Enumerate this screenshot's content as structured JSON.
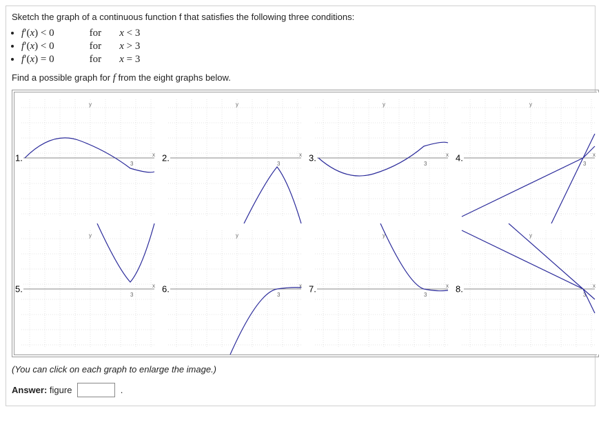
{
  "prompt": "Sketch the graph of a continuous function f that satisfies the following three conditions:",
  "conditions": [
    {
      "expr": "f′(x) < 0",
      "for": "for",
      "where": "x < 3"
    },
    {
      "expr": "f′(x) < 0",
      "for": "for",
      "where": "x > 3"
    },
    {
      "expr": "f′(x) = 0",
      "for": "for",
      "where": "x = 3"
    }
  ],
  "find_text": "Find a possible graph for f from the eight graphs below.",
  "graphs": [
    {
      "num": "1."
    },
    {
      "num": "2."
    },
    {
      "num": "3."
    },
    {
      "num": "4."
    },
    {
      "num": "5."
    },
    {
      "num": "6."
    },
    {
      "num": "7."
    },
    {
      "num": "8."
    }
  ],
  "axis": {
    "x_label": "x",
    "y_label": "y",
    "tick": "3"
  },
  "hint": "(You can click on each graph to enlarge the image.)",
  "answer_label": "Answer:",
  "answer_word": "figure",
  "answer_value": "",
  "period": "."
}
